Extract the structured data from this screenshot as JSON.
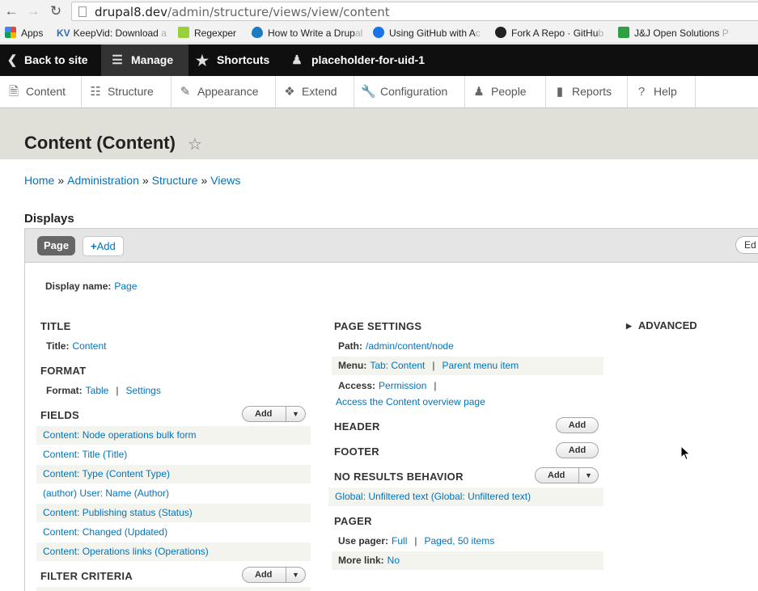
{
  "browser": {
    "url_host": "drupal8.dev",
    "url_path": "/admin/structure/views/view/content",
    "bookmarks": [
      {
        "label": "Apps",
        "faded": "",
        "color": "#e04a3f"
      },
      {
        "label": "KeepVid: Download",
        "faded": " a",
        "color": "#2d6cb5"
      },
      {
        "label": "Regexper",
        "faded": "",
        "color": "#9bcf3c"
      },
      {
        "label": "How to Write a Drup",
        "faded": "al",
        "color": "#1f7bc1"
      },
      {
        "label": "Using GitHub with A",
        "faded": "c",
        "color": "#1a73e8"
      },
      {
        "label": "Fork A Repo · GitHu",
        "faded": "b",
        "color": "#222222"
      },
      {
        "label": "J&J Open Solutions",
        "faded": " P",
        "color": "#2ea043"
      }
    ]
  },
  "toolbar": {
    "back": "Back to site",
    "manage": "Manage",
    "shortcuts": "Shortcuts",
    "user": "placeholder-for-uid-1"
  },
  "tray": [
    "Content",
    "Structure",
    "Appearance",
    "Extend",
    "Configuration",
    "People",
    "Reports",
    "Help"
  ],
  "page": {
    "title": "Content (Content)",
    "breadcrumb": [
      "Home",
      "Administration",
      "Structure",
      "Views"
    ],
    "displays_heading": "Displays",
    "tab_page": "Page",
    "tab_add": "Add",
    "tab_edit": "Ed",
    "display_name_label": "Display name:",
    "display_name_value": "Page"
  },
  "left": {
    "title_h": "TITLE",
    "title_label": "Title:",
    "title_value": "Content",
    "format_h": "FORMAT",
    "format_label": "Format:",
    "format_value": "Table",
    "format_settings": "Settings",
    "fields_h": "FIELDS",
    "fields_add": "Add",
    "fields": [
      "Content: Node operations bulk form",
      "Content: Title (Title)",
      "Content: Type (Content Type)",
      "(author) User: Name (Author)",
      "Content: Publishing status (Status)",
      "Content: Changed (Updated)",
      "Content: Operations links (Operations)"
    ],
    "filter_h": "FILTER CRITERIA",
    "filter_add": "Add"
  },
  "middle": {
    "page_settings_h": "PAGE SETTINGS",
    "path_label": "Path:",
    "path_value": "/admin/content/node",
    "menu_label": "Menu:",
    "menu_value": "Tab: Content",
    "menu_parent": "Parent menu item",
    "access_label": "Access:",
    "access_value": "Permission",
    "access_detail": "Access the Content overview page",
    "header_h": "HEADER",
    "header_add": "Add",
    "footer_h": "FOOTER",
    "footer_add": "Add",
    "noresults_h": "NO RESULTS BEHAVIOR",
    "noresults_add": "Add",
    "noresults_value": "Global: Unfiltered text (Global: Unfiltered text)",
    "pager_h": "PAGER",
    "pager_label": "Use pager:",
    "pager_value": "Full",
    "pager_detail": "Paged, 50 items",
    "more_label": "More link:",
    "more_value": "No"
  },
  "right": {
    "advanced": "ADVANCED"
  }
}
